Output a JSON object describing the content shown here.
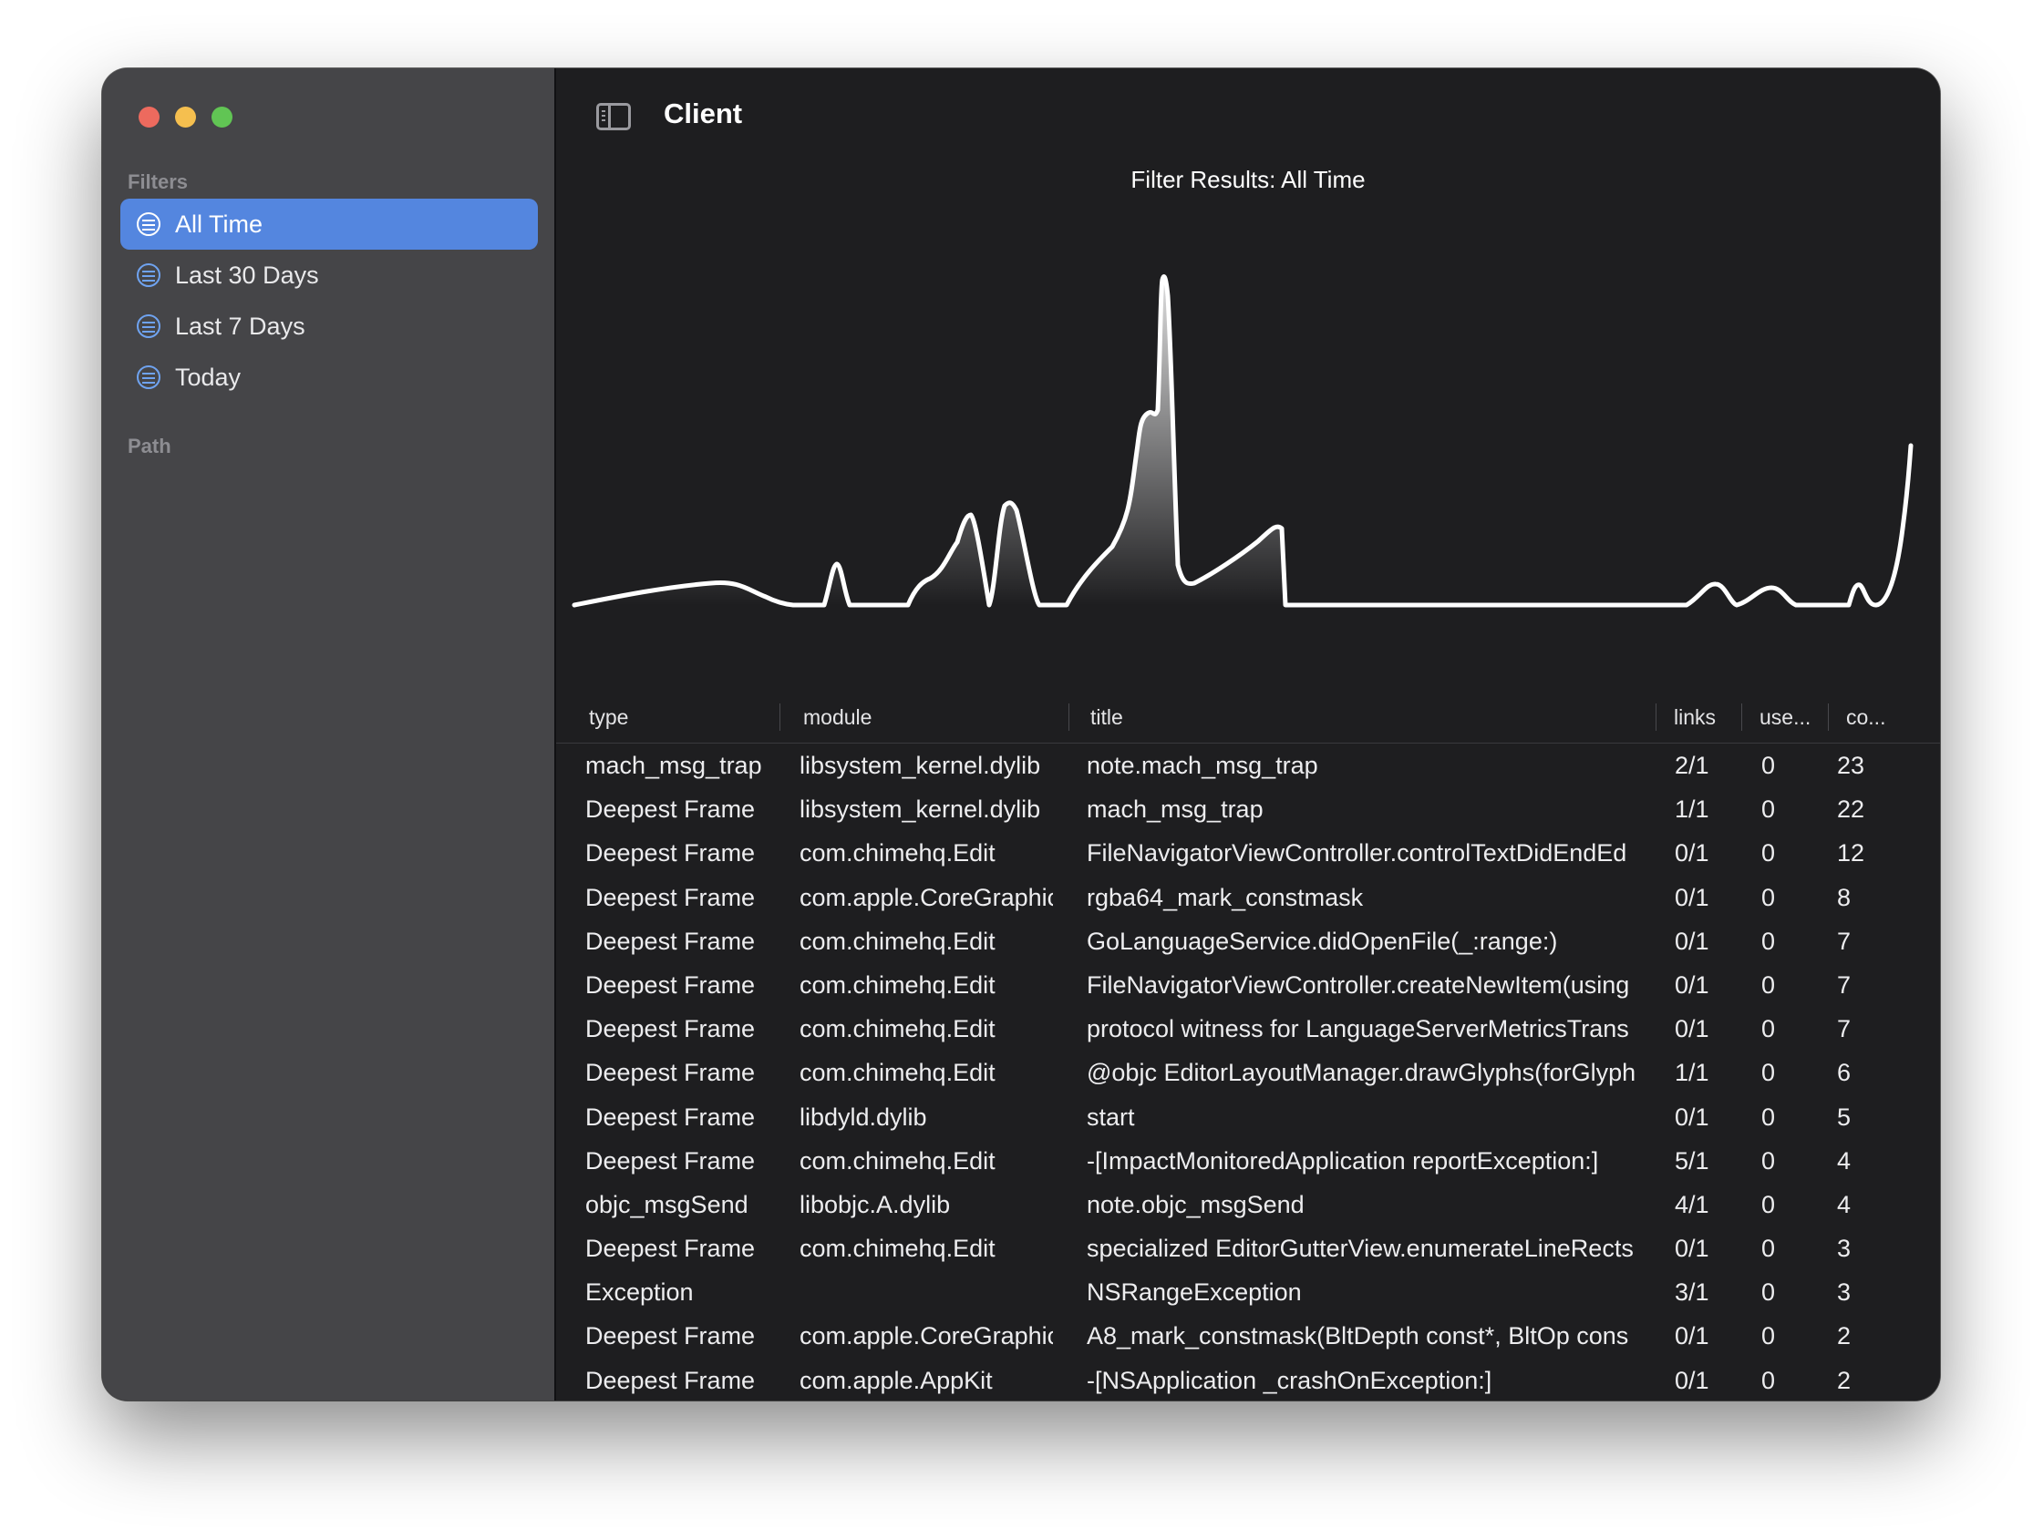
{
  "sidebar": {
    "filters_label": "Filters",
    "filters": [
      {
        "label": "All Time",
        "selected": true
      },
      {
        "label": "Last 30 Days",
        "selected": false
      },
      {
        "label": "Last 7 Days",
        "selected": false
      },
      {
        "label": "Today",
        "selected": false
      }
    ],
    "path_label": "Path"
  },
  "toolbar": {
    "title": "Client",
    "sidebar_toggle_icon": "sidebar-left-icon"
  },
  "chart": {
    "title": "Filter Results: All Time"
  },
  "table": {
    "columns": [
      "type",
      "module",
      "title",
      "links",
      "use...",
      "co..."
    ],
    "rows": [
      [
        "mach_msg_trap",
        "libsystem_kernel.dylib",
        "note.mach_msg_trap",
        "2/1",
        "0",
        "23"
      ],
      [
        "Deepest Frame",
        "libsystem_kernel.dylib",
        "mach_msg_trap",
        "1/1",
        "0",
        "22"
      ],
      [
        "Deepest Frame",
        "com.chimehq.Edit",
        "FileNavigatorViewController.controlTextDidEndEd",
        "0/1",
        "0",
        "12"
      ],
      [
        "Deepest Frame",
        "com.apple.CoreGraphic",
        "rgba64_mark_constmask",
        "0/1",
        "0",
        "8"
      ],
      [
        "Deepest Frame",
        "com.chimehq.Edit",
        "GoLanguageService.didOpenFile(_:range:)",
        "0/1",
        "0",
        "7"
      ],
      [
        "Deepest Frame",
        "com.chimehq.Edit",
        "FileNavigatorViewController.createNewItem(using",
        "0/1",
        "0",
        "7"
      ],
      [
        "Deepest Frame",
        "com.chimehq.Edit",
        "protocol witness for LanguageServerMetricsTrans",
        "0/1",
        "0",
        "7"
      ],
      [
        "Deepest Frame",
        "com.chimehq.Edit",
        "@objc EditorLayoutManager.drawGlyphs(forGlyph",
        "1/1",
        "0",
        "6"
      ],
      [
        "Deepest Frame",
        "libdyld.dylib",
        "start",
        "0/1",
        "0",
        "5"
      ],
      [
        "Deepest Frame",
        "com.chimehq.Edit",
        "-[ImpactMonitoredApplication reportException:]",
        "5/1",
        "0",
        "4"
      ],
      [
        "objc_msgSend",
        "libobjc.A.dylib",
        "note.objc_msgSend",
        "4/1",
        "0",
        "4"
      ],
      [
        "Deepest Frame",
        "com.chimehq.Edit",
        "specialized EditorGutterView.enumerateLineRects",
        "0/1",
        "0",
        "3"
      ],
      [
        "Exception",
        "",
        "NSRangeException",
        "3/1",
        "0",
        "3"
      ],
      [
        "Deepest Frame",
        "com.apple.CoreGraphic",
        "A8_mark_constmask(BltDepth const*, BltOp cons",
        "0/1",
        "0",
        "2"
      ],
      [
        "Deepest Frame",
        "com.apple.AppKit",
        "-[NSApplication _crashOnException:]",
        "0/1",
        "0",
        "2"
      ]
    ]
  }
}
